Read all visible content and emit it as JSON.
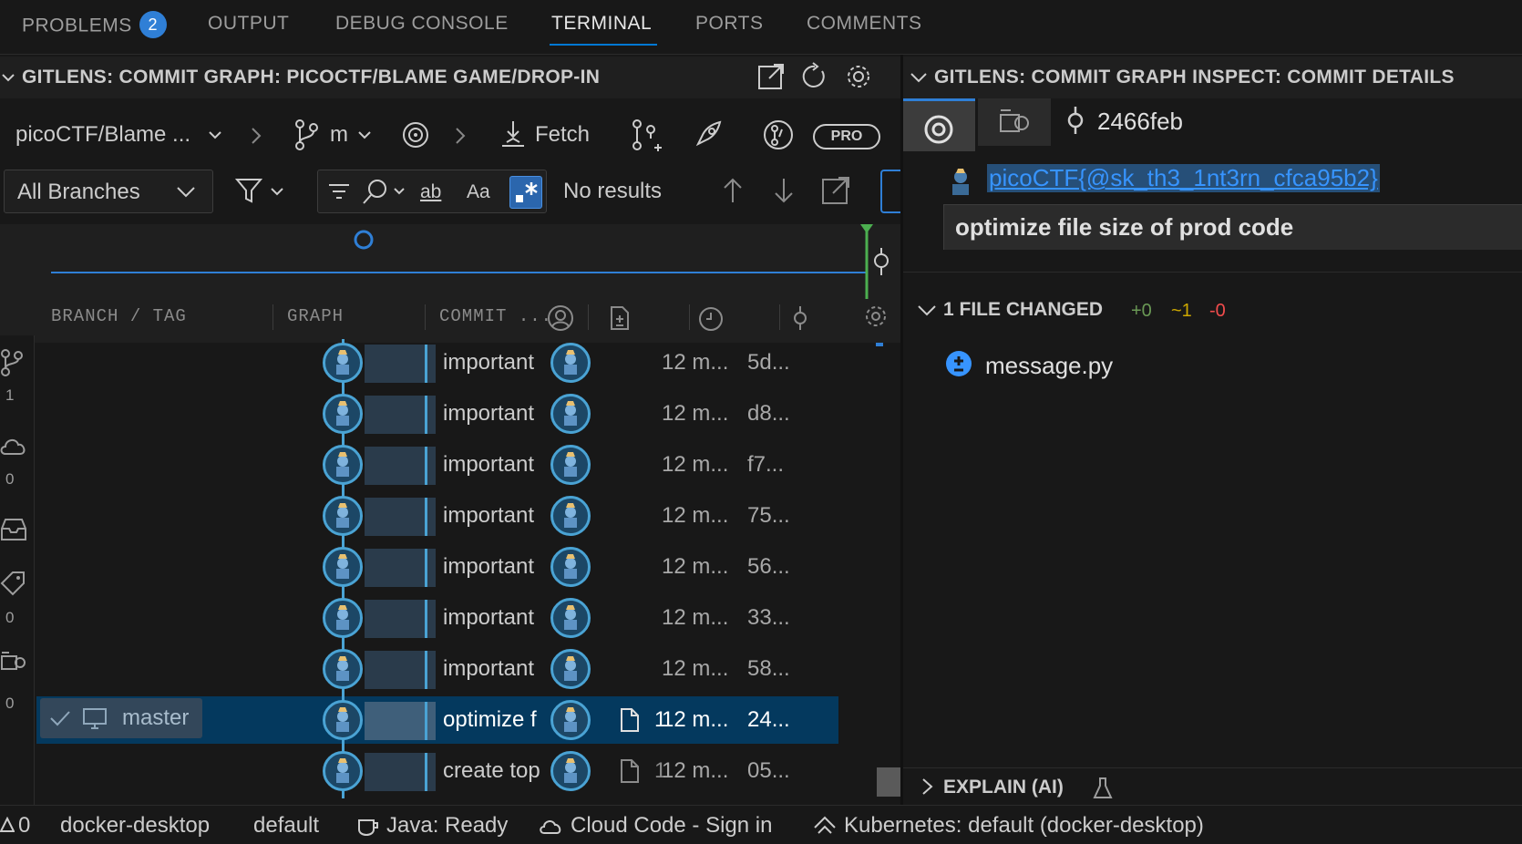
{
  "panel_tabs": [
    {
      "label": "PROBLEMS",
      "badge": "2"
    },
    {
      "label": "OUTPUT"
    },
    {
      "label": "DEBUG CONSOLE"
    },
    {
      "label": "TERMINAL",
      "active": true
    },
    {
      "label": "PORTS"
    },
    {
      "label": "COMMENTS"
    }
  ],
  "graph_panel": {
    "title": "GITLENS: COMMIT GRAPH: PICOCTF/BLAME GAME/DROP-IN",
    "repo": "picoCTF/Blame ...",
    "branch": "m",
    "fetch_label": "Fetch",
    "pro_label": "PRO",
    "branch_filter": "All Branches",
    "search_results": "No results",
    "search_opt_word": "ab",
    "search_opt_case": "Aa",
    "columns": {
      "branch": "BRANCH / TAG",
      "graph": "GRAPH",
      "commit": "COMMIT ..."
    },
    "side_counts": {
      "branches": "1",
      "remotes": "0",
      "tags": "0",
      "worktrees": "0"
    },
    "commits": [
      {
        "message": "important",
        "changes": "",
        "date": "12 m...",
        "sha": "5d..."
      },
      {
        "message": "important",
        "changes": "",
        "date": "12 m...",
        "sha": "d8..."
      },
      {
        "message": "important",
        "changes": "",
        "date": "12 m...",
        "sha": "f7..."
      },
      {
        "message": "important",
        "changes": "",
        "date": "12 m...",
        "sha": "75..."
      },
      {
        "message": "important",
        "changes": "",
        "date": "12 m...",
        "sha": "56..."
      },
      {
        "message": "important",
        "changes": "",
        "date": "12 m...",
        "sha": "33..."
      },
      {
        "message": "important",
        "changes": "",
        "date": "12 m...",
        "sha": "58..."
      },
      {
        "message": "optimize f",
        "changes": "1",
        "date": "12 m...",
        "sha": "24...",
        "branch": "master",
        "selected": true
      },
      {
        "message": "create top",
        "changes": "1",
        "date": "12 m...",
        "sha": "05..."
      }
    ]
  },
  "details_panel": {
    "title": "GITLENS: COMMIT GRAPH INSPECT: COMMIT DETAILS",
    "sha": "2466feb",
    "author": "picoCTF{@sk_th3_1nt3rn_cfca95b2}",
    "message": "optimize file size of prod code",
    "files_header": "1 FILE CHANGED",
    "stat_add": "+0",
    "stat_mod": "~1",
    "stat_del": "-0",
    "files": [
      "message.py"
    ],
    "explain_label": "EXPLAIN (AI)"
  },
  "status_bar": {
    "problems_count": "0",
    "context": "docker-desktop",
    "namespace": "default",
    "java": "Java: Ready",
    "cloud": "Cloud Code - Sign in",
    "kubernetes": "Kubernetes: default (docker-desktop)"
  },
  "colors": {
    "accent": "#0078d4",
    "selection": "#04395e",
    "graph_node": "#4aa3d4",
    "graph_head": "#4caf50",
    "add": "#6a9955",
    "mod": "#cca700",
    "del": "#f14c4c"
  }
}
